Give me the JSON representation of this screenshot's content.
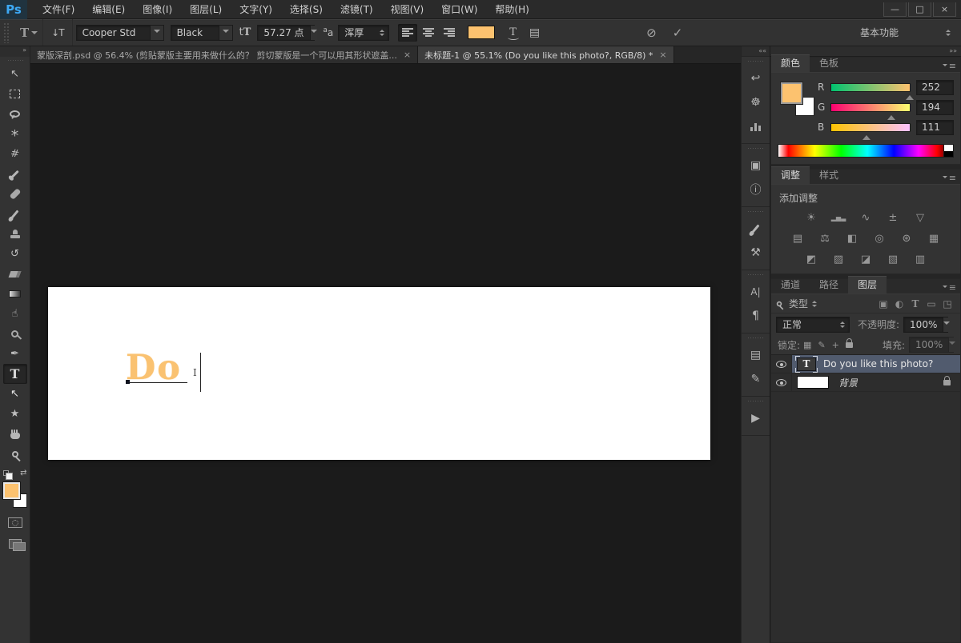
{
  "app": {
    "logo": "Ps",
    "accent_blue": "#3da9f5",
    "foreground_color": "#fcc26f"
  },
  "window_controls": {
    "minimize": "—",
    "maximize": "□",
    "close": "×"
  },
  "menu": {
    "items": [
      "文件(F)",
      "编辑(E)",
      "图像(I)",
      "图层(L)",
      "文字(Y)",
      "选择(S)",
      "滤镜(T)",
      "视图(V)",
      "窗口(W)",
      "帮助(H)"
    ]
  },
  "options_bar": {
    "tool_glyph": "T",
    "orientation_glyph": "↓T",
    "font_family": "Cooper Std",
    "font_style": "Black",
    "font_size": "57.27 点",
    "anti_alias_glyph": "aa",
    "anti_alias": "浑厚",
    "warp_glyph": "T",
    "panels_glyph": "▤",
    "cancel_glyph": "⊘",
    "commit_glyph": "✓",
    "workspace": "基本功能"
  },
  "tabs": [
    {
      "title": "蒙版深剖.psd @ 56.4% (剪贴蒙版主要用来做什么的？ 剪切蒙版是一个可以用其形状遮盖...",
      "close": "×"
    },
    {
      "title": "未标题-1 @ 55.1% (Do you like this photo?, RGB/8) *",
      "close": "×"
    }
  ],
  "toolbar": {
    "collapse_glyph": "»",
    "tools": [
      {
        "name": "move-tool",
        "icon": "move-icon",
        "glyph": "↖",
        "icls": "",
        "slot": ""
      },
      {
        "name": "marquee-tool",
        "icon": "marquee-icon",
        "glyph": "",
        "icls": "i-marquee",
        "slot": ""
      },
      {
        "name": "lasso-tool",
        "icon": "lasso-icon",
        "glyph": "",
        "icls": "i-lasso",
        "slot": ""
      },
      {
        "name": "quick-selection-tool",
        "icon": "magic-wand-icon",
        "glyph": "*",
        "icls": "i-wand",
        "slot": ""
      },
      {
        "name": "crop-tool",
        "icon": "crop-icon",
        "glyph": "#",
        "icls": "i-crop",
        "slot": ""
      },
      {
        "name": "eyedropper-tool",
        "icon": "eyedropper-icon",
        "glyph": "",
        "icls": "i-dropper",
        "slot": ""
      },
      {
        "name": "spot-healing-tool",
        "icon": "healing-icon",
        "glyph": "",
        "icls": "i-healing",
        "slot": ""
      },
      {
        "name": "brush-tool",
        "icon": "brush-icon",
        "glyph": "",
        "icls": "i-brush",
        "slot": ""
      },
      {
        "name": "clone-stamp-tool",
        "icon": "stamp-icon",
        "glyph": "",
        "icls": "i-stamp",
        "slot": ""
      },
      {
        "name": "history-brush-tool",
        "icon": "history-brush-icon",
        "glyph": "↺",
        "icls": "",
        "slot": ""
      },
      {
        "name": "eraser-tool",
        "icon": "eraser-icon",
        "glyph": "",
        "icls": "i-eraser",
        "slot": ""
      },
      {
        "name": "gradient-tool",
        "icon": "gradient-icon",
        "glyph": "",
        "icls": "i-gradient",
        "slot": ""
      },
      {
        "name": "smudge-tool",
        "icon": "smudge-icon",
        "glyph": "☝",
        "icls": "",
        "slot": ""
      },
      {
        "name": "dodge-tool",
        "icon": "dodge-icon",
        "glyph": "",
        "icls": "i-dodge",
        "slot": ""
      },
      {
        "name": "pen-tool",
        "icon": "pen-icon",
        "glyph": "✒",
        "icls": "",
        "slot": ""
      },
      {
        "name": "type-tool",
        "icon": "type-icon",
        "glyph": "T",
        "icls": "i-type",
        "slot": "active"
      },
      {
        "name": "path-selection-tool",
        "icon": "path-select-icon",
        "glyph": "↖",
        "icls": "i-light",
        "slot": ""
      },
      {
        "name": "custom-shape-tool",
        "icon": "shape-icon",
        "glyph": "★",
        "icls": "",
        "slot": ""
      },
      {
        "name": "hand-tool",
        "icon": "hand-icon",
        "glyph": "",
        "icls": "i-hand",
        "slot": ""
      },
      {
        "name": "zoom-tool",
        "icon": "zoom-icon",
        "glyph": "",
        "icls": "i-zoom",
        "slot": ""
      }
    ],
    "swap_glyph": "⇄"
  },
  "canvas": {
    "text": "Do",
    "text_color": "#fac271",
    "ibeam_glyph": "I"
  },
  "midstrip": {
    "collapse_glyph": "««",
    "groups": [
      [
        {
          "name": "history-panel-icon",
          "glyph": "↩",
          "icls": ""
        },
        {
          "name": "navigator-panel-icon",
          "glyph": "☸",
          "icls": ""
        },
        {
          "name": "histogram-panel-icon",
          "glyph": "",
          "icls": "i-bars"
        }
      ],
      [
        {
          "name": "properties-panel-icon",
          "glyph": "▣",
          "icls": ""
        },
        {
          "name": "info-panel-icon",
          "glyph": "ⓘ",
          "icls": ""
        }
      ],
      [
        {
          "name": "brush-presets-panel-icon",
          "glyph": "",
          "icls": "i-brush"
        },
        {
          "name": "tool-presets-panel-icon",
          "glyph": "⚒",
          "icls": ""
        }
      ],
      [
        {
          "name": "character-panel-icon",
          "glyph": "A|",
          "icls": "sm"
        },
        {
          "name": "paragraph-panel-icon",
          "glyph": "¶",
          "icls": ""
        }
      ],
      [
        {
          "name": "layer-comps-panel-icon",
          "glyph": "▤",
          "icls": ""
        },
        {
          "name": "notes-panel-icon",
          "glyph": "✎",
          "icls": ""
        }
      ],
      [
        {
          "name": "actions-panel-icon",
          "glyph": "▶",
          "icls": ""
        }
      ]
    ]
  },
  "right_header": {
    "collapse_glyph": "»»"
  },
  "color_panel": {
    "tabs": [
      "颜色",
      "色板"
    ],
    "menu_glyph": "≡",
    "channels": [
      {
        "label": "R",
        "value": "252",
        "pos": 99
      },
      {
        "label": "G",
        "value": "194",
        "pos": 76
      },
      {
        "label": "B",
        "value": "111",
        "pos": 44
      }
    ]
  },
  "adjustments_panel": {
    "tabs": [
      "调整",
      "样式"
    ],
    "menu_glyph": "≡",
    "add_label": "添加调整",
    "rows": [
      [
        {
          "name": "brightness-contrast-icon",
          "glyph": "☀",
          "icls": ""
        },
        {
          "name": "levels-icon",
          "glyph": "▂▅▃",
          "icls": "tiny"
        },
        {
          "name": "curves-icon",
          "glyph": "∿",
          "icls": ""
        },
        {
          "name": "exposure-icon",
          "glyph": "±",
          "icls": ""
        },
        {
          "name": "vibrance-icon",
          "glyph": "▽",
          "icls": ""
        }
      ],
      [
        {
          "name": "hue-saturation-icon",
          "glyph": "▤",
          "icls": ""
        },
        {
          "name": "color-balance-icon",
          "glyph": "⚖",
          "icls": ""
        },
        {
          "name": "black-white-icon",
          "glyph": "◧",
          "icls": ""
        },
        {
          "name": "photo-filter-icon",
          "glyph": "◎",
          "icls": ""
        },
        {
          "name": "channel-mixer-icon",
          "glyph": "⊛",
          "icls": ""
        },
        {
          "name": "color-lookup-icon",
          "glyph": "▦",
          "icls": ""
        }
      ],
      [
        {
          "name": "invert-icon",
          "glyph": "◩",
          "icls": ""
        },
        {
          "name": "posterize-icon",
          "glyph": "▨",
          "icls": ""
        },
        {
          "name": "threshold-icon",
          "glyph": "◪",
          "icls": ""
        },
        {
          "name": "gradient-map-icon",
          "glyph": "▧",
          "icls": ""
        },
        {
          "name": "selective-color-icon",
          "glyph": "▥",
          "icls": ""
        }
      ]
    ]
  },
  "layers_panel": {
    "tabs": [
      "通道",
      "路径",
      "图层"
    ],
    "menu_glyph": "≡",
    "filter_label": "类型",
    "filter_icons": [
      {
        "name": "filter-pixel-layers-icon",
        "glyph": "▣",
        "icls": ""
      },
      {
        "name": "filter-adjustment-layers-icon",
        "glyph": "◐",
        "icls": ""
      },
      {
        "name": "filter-type-layers-icon",
        "glyph": "T",
        "icls": "ser"
      },
      {
        "name": "filter-shape-layers-icon",
        "glyph": "▭",
        "icls": ""
      },
      {
        "name": "filter-smart-objects-icon",
        "glyph": "◳",
        "icls": ""
      }
    ],
    "blend_mode": "正常",
    "opacity_label": "不透明度:",
    "opacity": "100%",
    "lock_label": "锁定:",
    "lock_transparency_glyph": "▦",
    "lock_pixels_glyph": "✎",
    "lock_position_glyph": "+",
    "fill_label": "填充:",
    "fill": "100%",
    "layers": [
      {
        "name": "Do you like this photo?",
        "type": "text"
      },
      {
        "name": "背景",
        "type": "background"
      }
    ]
  }
}
